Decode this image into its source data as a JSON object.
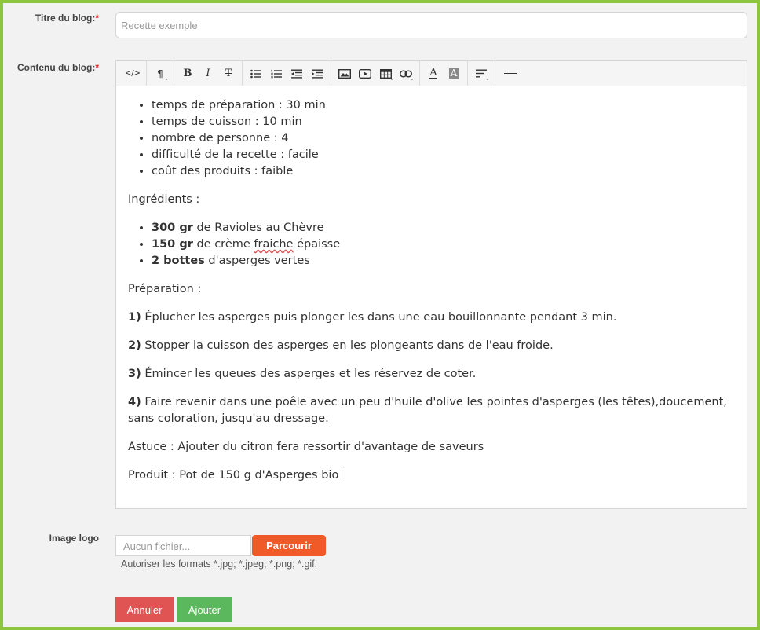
{
  "form": {
    "title_label": "Titre du blog:",
    "content_label": "Contenu du blog:",
    "image_label": "Image logo",
    "required_mark": "*",
    "title_placeholder": "Recette exemple",
    "file_placeholder": "Aucun fichier...",
    "browse_label": "Parcourir",
    "formats_note": "Autoriser les formats *.jpg; *.jpeg; *.png; *.gif.",
    "cancel_label": "Annuler",
    "add_label": "Ajouter"
  },
  "toolbar": {
    "code_view": "</>",
    "paragraph": "¶",
    "bold": "B",
    "italic": "I",
    "strikethrough": "T",
    "ul": "≡",
    "ol": "≡",
    "outdent": "≡",
    "indent": "≡",
    "image": "image",
    "video": "video",
    "table": "table",
    "link": "link",
    "font_color": "A",
    "bg_color": "A",
    "align": "≡",
    "hr": "—"
  },
  "content": {
    "info_list": [
      "temps de préparation : 30 min",
      "temps de cuisson : 10 min",
      "nombre de personne : 4",
      "difficulté de la recette : facile",
      "coût des produits : faible"
    ],
    "ingredients_heading": "Ingrédients :",
    "ingredients": [
      {
        "qty": "300 gr",
        "text": " de Ravioles au Chèvre"
      },
      {
        "qty": "150 gr",
        "text_pre": " de crème ",
        "text_spell": "fraiche",
        "text_post": " épaisse"
      },
      {
        "qty": "2 bottes",
        "text": " d'asperges vertes"
      }
    ],
    "preparation_heading": "Préparation :",
    "steps": [
      {
        "num": "1)",
        "text": " Éplucher les asperges puis plonger les dans une eau bouillonnante pendant 3 min."
      },
      {
        "num": "2)",
        "text": " Stopper la cuisson des asperges en les plongeants dans de l'eau froide."
      },
      {
        "num": "3)",
        "text": " Émincer les queues des asperges et les réservez de coter."
      },
      {
        "num": "4)",
        "text": " Faire revenir dans une poêle avec un peu d'huile d'olive les pointes d'asperges (les têtes),doucement, sans coloration, jusqu'au dressage."
      }
    ],
    "tip": "Astuce : Ajouter du citron fera ressortir d'avantage de saveurs",
    "product": "Produit : Pot de 150 g d'Asperges bio"
  },
  "colors": {
    "frame_border": "#8cc63f",
    "browse_button": "#f05a28",
    "cancel_button": "#e05454",
    "add_button": "#5cb85c",
    "required": "#e02020"
  }
}
